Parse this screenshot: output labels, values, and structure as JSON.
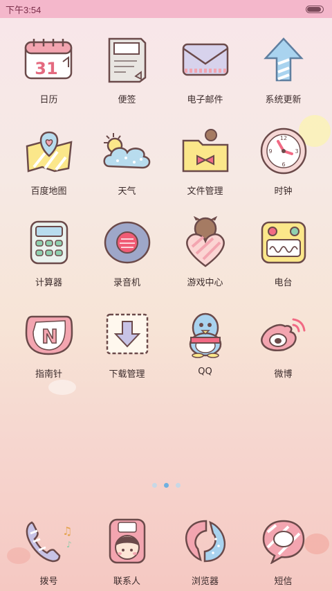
{
  "status_bar": {
    "time": "下午3:54",
    "battery_percent": 90
  },
  "apps": [
    {
      "name": "calendar",
      "label": "日历",
      "icon": "calendar-icon",
      "day": "31"
    },
    {
      "name": "notes",
      "label": "便签",
      "icon": "notes-icon"
    },
    {
      "name": "email",
      "label": "电子邮件",
      "icon": "envelope-icon"
    },
    {
      "name": "update",
      "label": "系统更新",
      "icon": "up-arrow-icon"
    },
    {
      "name": "map",
      "label": "百度地图",
      "icon": "map-pin-icon"
    },
    {
      "name": "weather",
      "label": "天气",
      "icon": "weather-icon"
    },
    {
      "name": "files",
      "label": "文件管理",
      "icon": "folder-icon"
    },
    {
      "name": "clock",
      "label": "时钟",
      "icon": "clock-icon",
      "numbers": [
        "12",
        "3",
        "6",
        "9"
      ]
    },
    {
      "name": "calculator",
      "label": "计算器",
      "icon": "calculator-icon"
    },
    {
      "name": "recorder",
      "label": "录音机",
      "icon": "recorder-icon"
    },
    {
      "name": "game",
      "label": "游戏中心",
      "icon": "heart-bear-icon"
    },
    {
      "name": "radio",
      "label": "电台",
      "icon": "radio-icon"
    },
    {
      "name": "compass",
      "label": "指南针",
      "icon": "compass-icon",
      "letter": "N"
    },
    {
      "name": "download",
      "label": "下载管理",
      "icon": "download-icon"
    },
    {
      "name": "qq",
      "label": "QQ",
      "icon": "penguin-icon"
    },
    {
      "name": "weibo",
      "label": "微博",
      "icon": "weibo-icon"
    }
  ],
  "page_indicator": {
    "pages": 3,
    "current": 2
  },
  "dock": [
    {
      "name": "dialer",
      "label": "拨号",
      "icon": "phone-icon"
    },
    {
      "name": "contacts",
      "label": "联系人",
      "icon": "contacts-icon"
    },
    {
      "name": "browser",
      "label": "浏览器",
      "icon": "browser-icon"
    },
    {
      "name": "sms",
      "label": "短信",
      "icon": "message-icon"
    }
  ],
  "colors": {
    "status_bar": "#f4b7cb",
    "outline": "#6b4a4a",
    "pink": "#f3a5b0",
    "blue": "#a9d3ef",
    "yellow": "#fbe78a",
    "accent_dot": "#6fb0e0"
  }
}
